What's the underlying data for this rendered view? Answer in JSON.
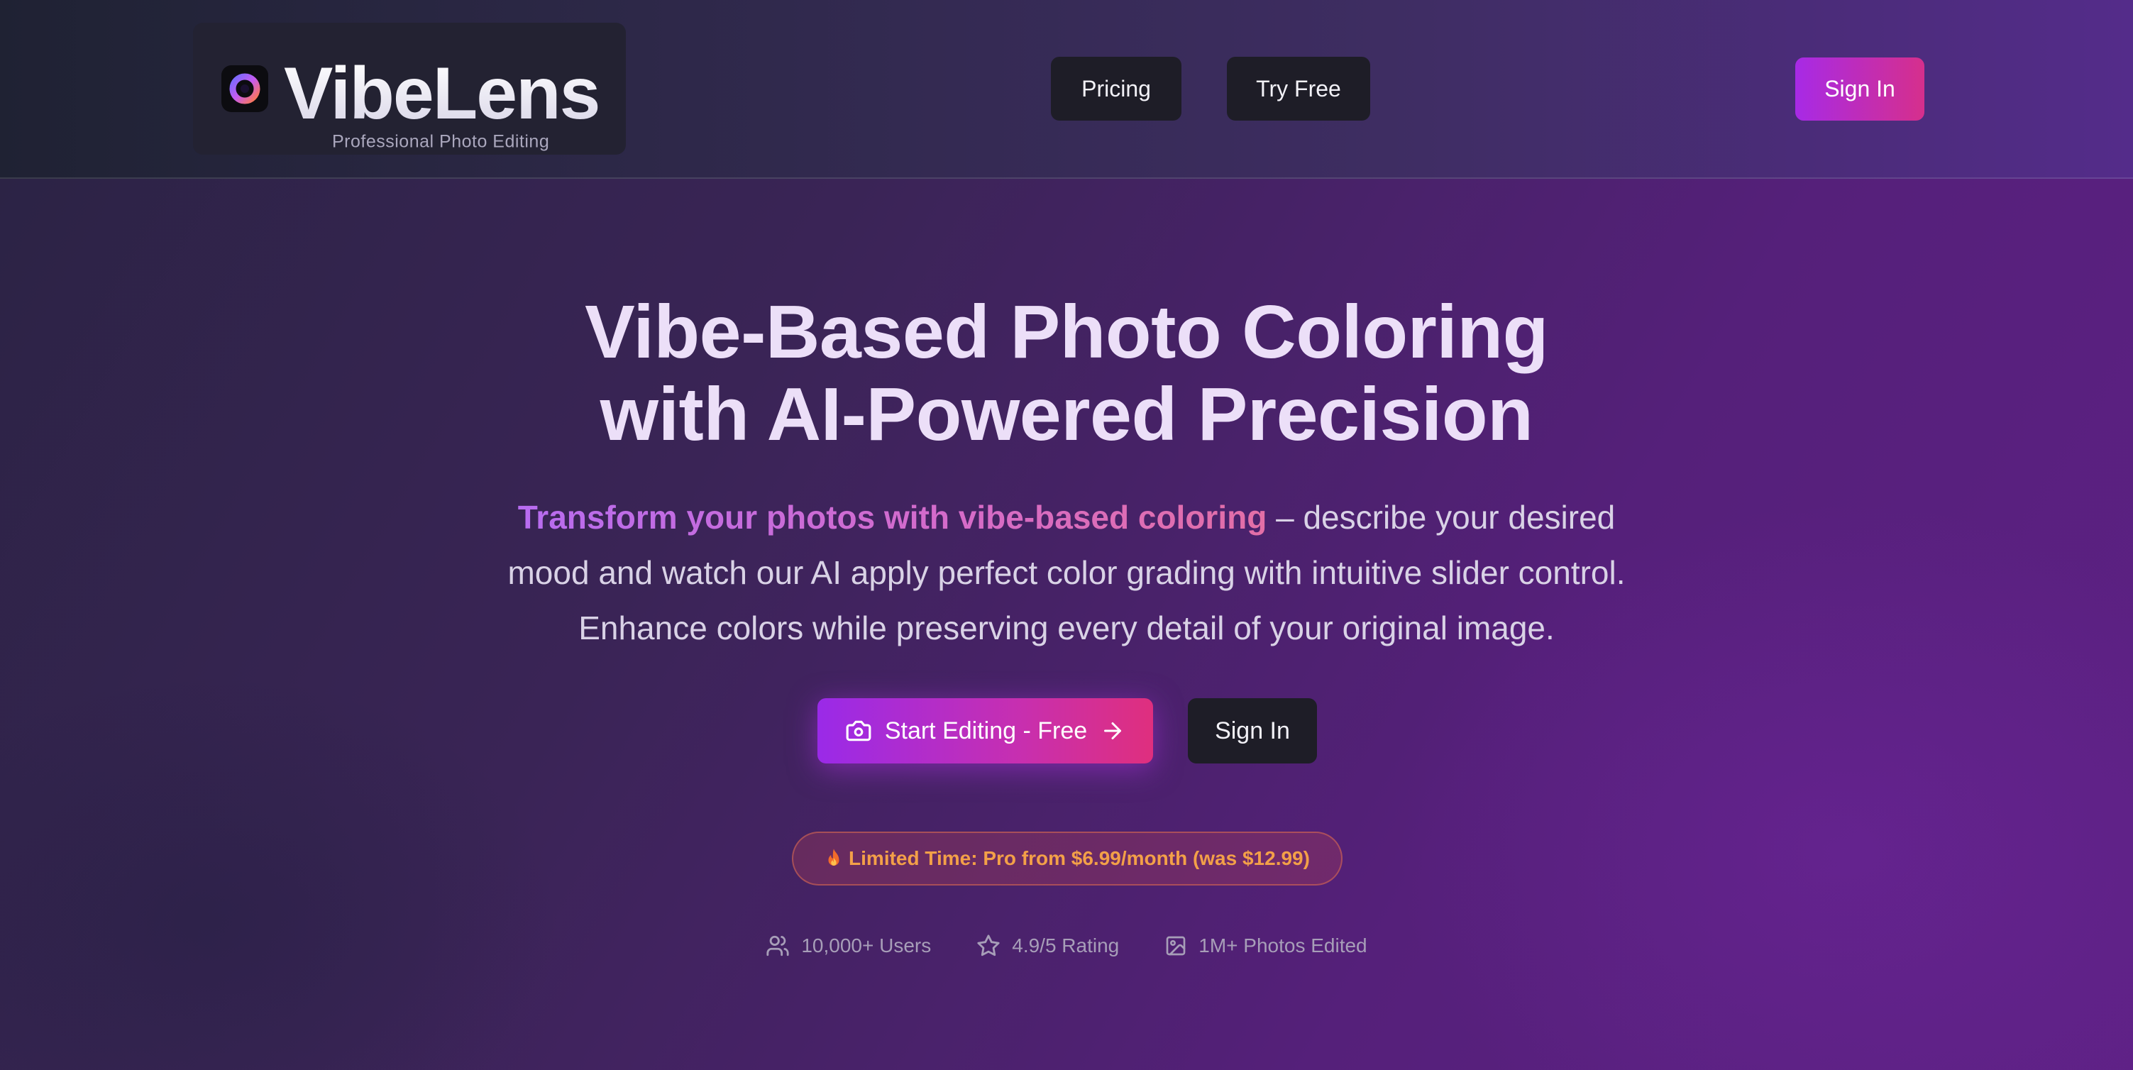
{
  "header": {
    "brand_name": "VibeLens",
    "brand_tagline": "Professional Photo Editing",
    "nav": [
      {
        "label": "Pricing"
      },
      {
        "label": "Try Free"
      }
    ],
    "signin_label": "Sign In",
    "logo_icon": "camera-lens-icon"
  },
  "hero": {
    "title_line1": "Vibe-Based Photo Coloring",
    "title_line2": "with AI-Powered Precision",
    "desc_highlight": "Transform your photos with vibe-based coloring",
    "desc_rest": " – describe your desired mood and watch our AI apply perfect color grading with intuitive slider control. Enhance colors while preserving every detail of your original image.",
    "cta_primary": "Start Editing - Free",
    "cta_primary_icon": "camera-icon",
    "cta_primary_trailing_icon": "arrow-right-icon",
    "cta_secondary": "Sign In",
    "promo_icon": "fire-icon",
    "promo_text": "Limited Time: Pro from $6.99/month (was $12.99)"
  },
  "stats": [
    {
      "icon": "users-icon",
      "label": "10,000+ Users"
    },
    {
      "icon": "star-icon",
      "label": "4.9/5 Rating"
    },
    {
      "icon": "image-icon",
      "label": "1M+ Photos Edited"
    }
  ],
  "colors": {
    "accent_start": "#a72ae6",
    "accent_end": "#d62f8c",
    "dark_button": "#1e1d27",
    "promo_text": "#f3a048"
  }
}
